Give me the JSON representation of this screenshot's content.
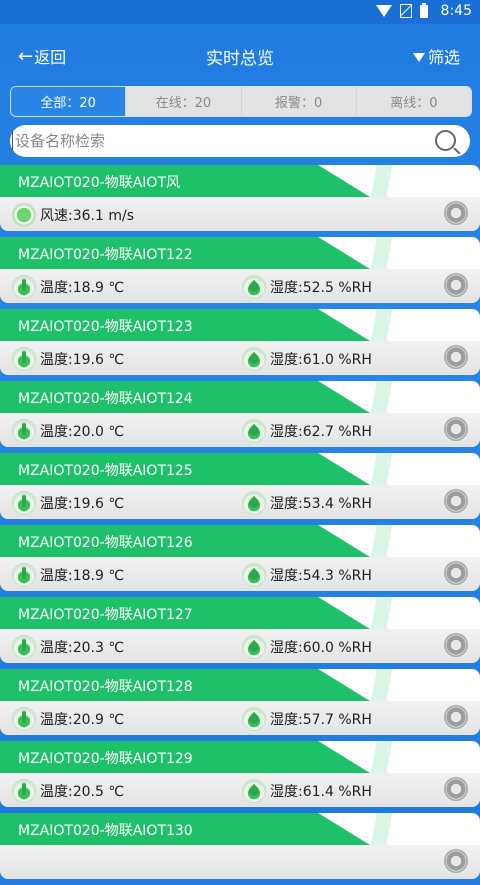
{
  "statusbar": {
    "time": "8:45"
  },
  "header": {
    "back_label": "返回",
    "title": "实时总览",
    "filter_label": "筛选"
  },
  "tabs": [
    {
      "label": "全部：20",
      "active": true
    },
    {
      "label": "在线：20",
      "active": false
    },
    {
      "label": "报警：0",
      "active": false
    },
    {
      "label": "离线：0",
      "active": false
    }
  ],
  "search": {
    "placeholder": "设备名称检索",
    "value": ""
  },
  "devices": [
    {
      "name": "MZAIOT020-物联AIOT风",
      "readings": [
        {
          "icon": "wind-icon",
          "text": "风速:36.1 m/s"
        }
      ]
    },
    {
      "name": "MZAIOT020-物联AIOT122",
      "readings": [
        {
          "icon": "thermometer-icon",
          "text": "温度:18.9 ℃"
        },
        {
          "icon": "humidity-drop-icon",
          "text": "湿度:52.5 %RH"
        }
      ]
    },
    {
      "name": "MZAIOT020-物联AIOT123",
      "readings": [
        {
          "icon": "thermometer-icon",
          "text": "温度:19.6 ℃"
        },
        {
          "icon": "humidity-drop-icon",
          "text": "湿度:61.0 %RH"
        }
      ]
    },
    {
      "name": "MZAIOT020-物联AIOT124",
      "readings": [
        {
          "icon": "thermometer-icon",
          "text": "温度:20.0 ℃"
        },
        {
          "icon": "humidity-drop-icon",
          "text": "湿度:62.7 %RH"
        }
      ]
    },
    {
      "name": "MZAIOT020-物联AIOT125",
      "readings": [
        {
          "icon": "thermometer-icon",
          "text": "温度:19.6 ℃"
        },
        {
          "icon": "humidity-drop-icon",
          "text": "湿度:53.4 %RH"
        }
      ]
    },
    {
      "name": "MZAIOT020-物联AIOT126",
      "readings": [
        {
          "icon": "thermometer-icon",
          "text": "温度:18.9 ℃"
        },
        {
          "icon": "humidity-drop-icon",
          "text": "湿度:54.3 %RH"
        }
      ]
    },
    {
      "name": "MZAIOT020-物联AIOT127",
      "readings": [
        {
          "icon": "thermometer-icon",
          "text": "温度:20.3 ℃"
        },
        {
          "icon": "humidity-drop-icon",
          "text": "湿度:60.0 %RH"
        }
      ]
    },
    {
      "name": "MZAIOT020-物联AIOT128",
      "readings": [
        {
          "icon": "thermometer-icon",
          "text": "温度:20.9 ℃"
        },
        {
          "icon": "humidity-drop-icon",
          "text": "湿度:57.7 %RH"
        }
      ]
    },
    {
      "name": "MZAIOT020-物联AIOT129",
      "readings": [
        {
          "icon": "thermometer-icon",
          "text": "温度:20.5 ℃"
        },
        {
          "icon": "humidity-drop-icon",
          "text": "湿度:61.4 %RH"
        }
      ]
    },
    {
      "name": "MZAIOT020-物联AIOT130",
      "readings": []
    }
  ],
  "colors": {
    "primary_blue": "#2a86e6",
    "header_green": "#1fc06a"
  }
}
